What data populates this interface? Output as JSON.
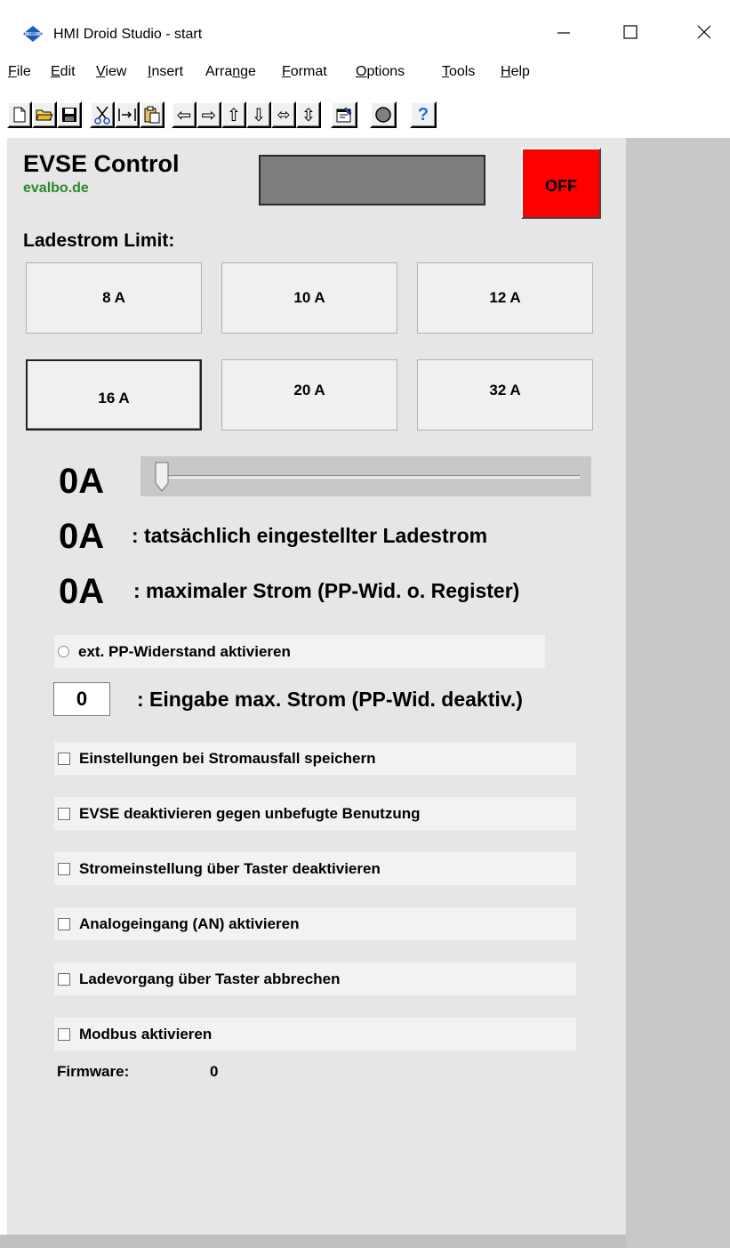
{
  "window": {
    "title": "HMI Droid Studio - start",
    "minimize_glyph": "—",
    "maximize_glyph": "☐",
    "close_glyph": "✕"
  },
  "menu": {
    "items": [
      {
        "u": "F",
        "rest": "ile"
      },
      {
        "u": "E",
        "rest": "dit"
      },
      {
        "u": "V",
        "rest": "iew"
      },
      {
        "u": "I",
        "rest": "nsert"
      },
      {
        "pre": "Arra",
        "u": "n",
        "rest": "ge"
      },
      {
        "u": "F",
        "rest": "ormat"
      },
      {
        "u": "O",
        "rest": "ptions"
      },
      {
        "u": "T",
        "rest": "ools"
      },
      {
        "u": "H",
        "rest": "elp"
      }
    ]
  },
  "toolbar": {
    "icons": [
      "new-file-icon",
      "open-folder-icon",
      "save-icon",
      "cut-icon",
      "copy-icon",
      "paste-icon",
      "arrow-left-icon",
      "arrow-right-icon",
      "arrow-up-icon",
      "arrow-down-icon",
      "arrow-left-right-icon",
      "arrow-up-down-icon",
      "properties-icon",
      "record-icon",
      "help-icon"
    ],
    "glyphs": {
      "arrow_left": "⇦",
      "arrow_right": "⇨",
      "arrow_up": "⇧",
      "arrow_down": "⇩",
      "arrow_lr": "⬄",
      "arrow_ud": "⇳",
      "help": "?"
    }
  },
  "header": {
    "title": "EVSE Control",
    "subtitle": "evalbo.de",
    "status_text": "",
    "off_button": "OFF"
  },
  "limits": {
    "label": "Ladestrom Limit:",
    "buttons": [
      "8 A",
      "10 A",
      "12 A",
      "16 A",
      "20 A",
      "32 A"
    ],
    "pressed_index": 3
  },
  "slider": {
    "value_label": "0A",
    "value": 0
  },
  "readings": {
    "actual_value": "0A",
    "actual_label": ": tatsächlich eingestellter Ladestrom",
    "max_value": "0A",
    "max_label": ": maximaler Strom (PP-Wid. o. Register)"
  },
  "pp_resistor": {
    "label": "ext. PP-Widerstand aktivieren",
    "selected": false
  },
  "max_current_input": {
    "value": "0",
    "label": ": Eingabe max. Strom (PP-Wid. deaktiv.)"
  },
  "options": [
    {
      "label": "Einstellungen bei Stromausfall speichern",
      "checked": false
    },
    {
      "label": "EVSE deaktivieren gegen unbefugte Benutzung",
      "checked": false
    },
    {
      "label": "Stromeinstellung über Taster deaktivieren",
      "checked": false
    },
    {
      "label": "Analogeingang (AN) aktivieren",
      "checked": false
    },
    {
      "label": "Ladevorgang über Taster abbrechen",
      "checked": false
    },
    {
      "label": "Modbus aktivieren",
      "checked": false
    }
  ],
  "firmware": {
    "label": "Firmware:",
    "value": "0"
  },
  "colors": {
    "off_button": "#ff0000",
    "subtitle": "#2a8a2a",
    "panel": "#e6e6e6",
    "status_box": "#7d7d7d"
  }
}
